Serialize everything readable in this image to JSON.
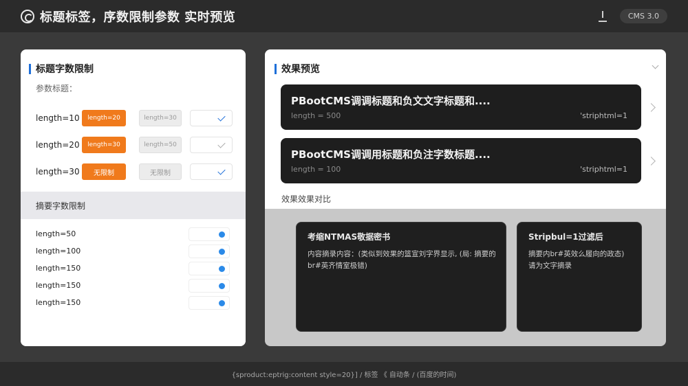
{
  "header": {
    "title": "标题标签，序数限制参数",
    "title_suffix": "实时预览",
    "badge": "CMS 3.0"
  },
  "left_panel": {
    "title": "标题字数限制",
    "subtitle": "参数标题：",
    "title_rows": [
      {
        "label": "length=10",
        "option_active": "length=20",
        "option_alt": "length=30"
      },
      {
        "label": "length=20",
        "option_active": "length=30",
        "option_alt": "length=50"
      },
      {
        "label": "length=30",
        "option_active": "无限制",
        "option_alt": "无限制"
      }
    ],
    "summary_title": "摘要字数限制",
    "summary_rows": [
      "length=50",
      "length=100",
      "length=150",
      "length=150",
      "length=150"
    ]
  },
  "right_panel": {
    "title": "效果预览",
    "cards": [
      {
        "title": "PBootCMS调调标题和负文文字标题和....",
        "meta": "length = 500",
        "flag": "'striphtml=1"
      },
      {
        "title": "PBootCMS调调用标题和负注字数标题....",
        "meta": "length = 100",
        "flag": "'striphtml=1"
      }
    ],
    "compare_label": "效果效果对比",
    "compare_cards": [
      {
        "title": "考缩NTMAS敬据密书",
        "body": "内容摘录内容：(类似到效果的篮宣刘字界显示, (局: 摘要的br#英齐情室极错)"
      },
      {
        "title": "Stripbul=1过滤后",
        "body": "摘要内br#英效么履向的政态) 请为文字摘录"
      }
    ]
  },
  "footer": {
    "text": "{sproduct:eptrig:content style=20}] / 标签 《 自动条 / (百度的时间)"
  },
  "colors": {
    "accent": "#1e6fd9",
    "orange": "#f07a1c",
    "dark_card": "#1e1e1e"
  }
}
